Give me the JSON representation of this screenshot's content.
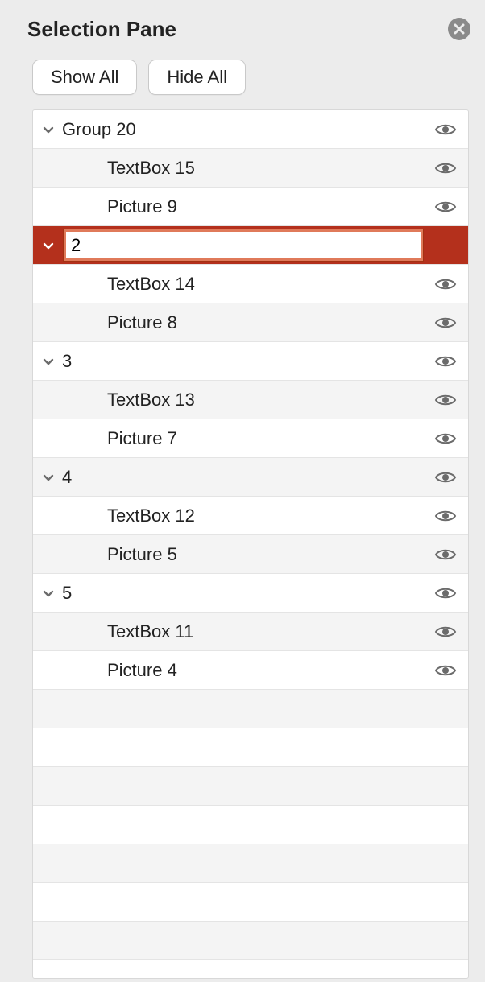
{
  "pane": {
    "title": "Selection Pane"
  },
  "toolbar": {
    "show_all": "Show All",
    "hide_all": "Hide All"
  },
  "colors": {
    "selected_bg": "#b4301c"
  },
  "rename_value": "2",
  "items": [
    {
      "kind": "group",
      "label": "Group 20",
      "expanded": true,
      "visible": true
    },
    {
      "kind": "child",
      "label": "TextBox 15",
      "visible": true
    },
    {
      "kind": "child",
      "label": "Picture 9",
      "visible": true
    },
    {
      "kind": "group",
      "label": "2",
      "expanded": true,
      "visible": true,
      "editing": true
    },
    {
      "kind": "child",
      "label": "TextBox 14",
      "visible": true
    },
    {
      "kind": "child",
      "label": "Picture 8",
      "visible": true
    },
    {
      "kind": "group",
      "label": "3",
      "expanded": true,
      "visible": true
    },
    {
      "kind": "child",
      "label": "TextBox 13",
      "visible": true
    },
    {
      "kind": "child",
      "label": "Picture 7",
      "visible": true
    },
    {
      "kind": "group",
      "label": "4",
      "expanded": true,
      "visible": true
    },
    {
      "kind": "child",
      "label": "TextBox 12",
      "visible": true
    },
    {
      "kind": "child",
      "label": "Picture 5",
      "visible": true
    },
    {
      "kind": "group",
      "label": "5",
      "expanded": true,
      "visible": true
    },
    {
      "kind": "child",
      "label": "TextBox 11",
      "visible": true
    },
    {
      "kind": "child",
      "label": "Picture 4",
      "visible": true
    }
  ],
  "empty_rows": 7
}
